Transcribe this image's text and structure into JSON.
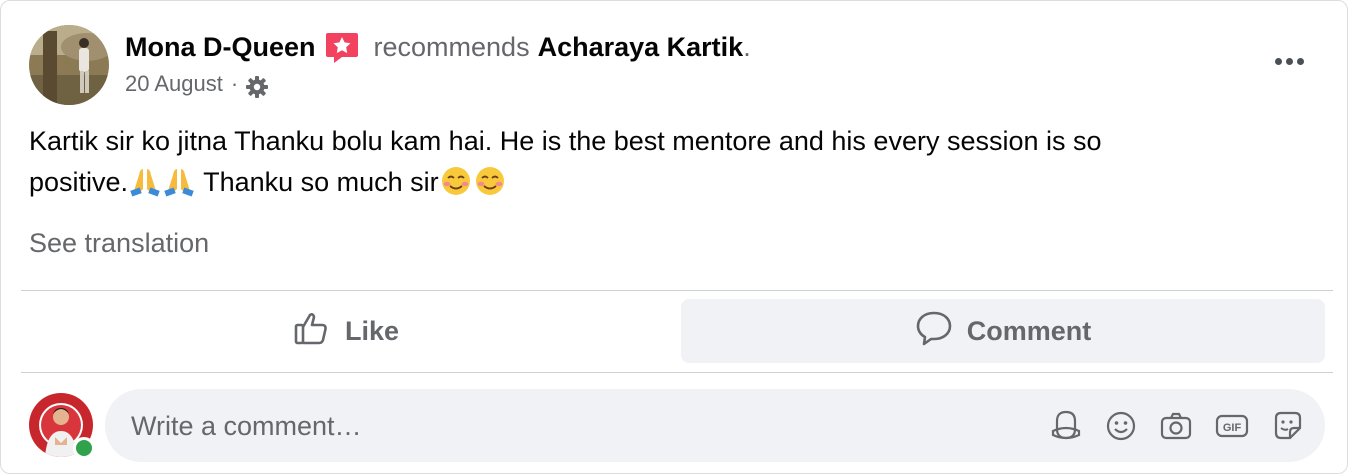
{
  "post": {
    "author": "Mona D-Queen",
    "recommends_text": "recommends",
    "recommended_page": "Acharaya Kartik",
    "period": ".",
    "date": "20 August",
    "meta_separator": "·",
    "body_line1": "Kartik sir ko jitna Thanku bolu kam hai. He is the best mentore and his every session is so",
    "body_line2_a": "positive.",
    "body_line2_b": " Thanku so much sir",
    "emojis": [
      "folded-hands",
      "folded-hands",
      "smiling-face",
      "smiling-face"
    ],
    "see_translation": "See translation"
  },
  "actions": {
    "like_label": "Like",
    "comment_label": "Comment"
  },
  "composer": {
    "placeholder": "Write a comment…",
    "tools": [
      "avatar-sticker-icon",
      "emoji-icon",
      "camera-icon",
      "gif-icon",
      "sticker-icon"
    ]
  },
  "colors": {
    "recommend_badge": "#f3425f",
    "secondary_text": "#65676b",
    "online": "#31a24c",
    "comment_button_bg": "#f0f2f5"
  }
}
